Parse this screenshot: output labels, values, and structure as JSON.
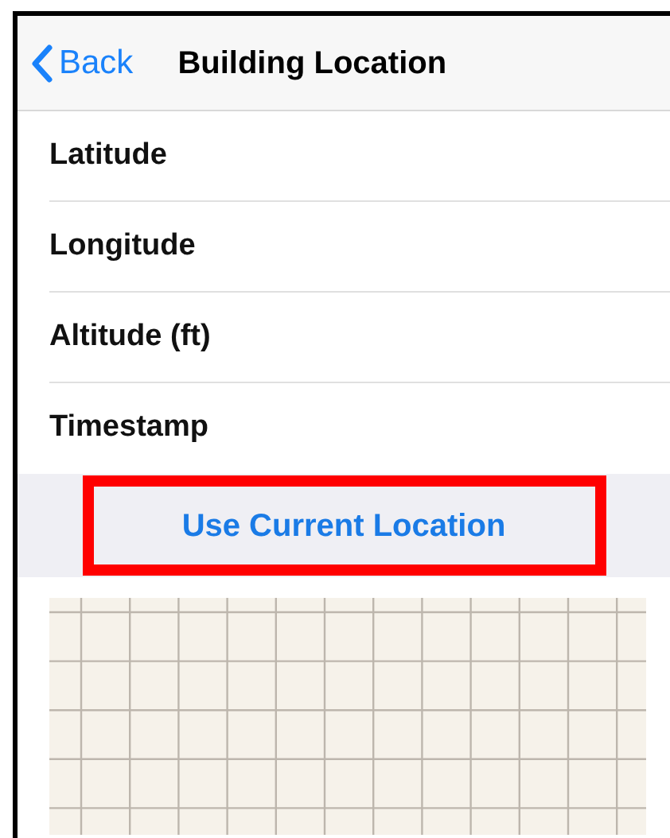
{
  "nav_bar": {
    "back": "Back",
    "title": "Building Location"
  },
  "fields": [
    {
      "label": "Latitude"
    },
    {
      "label": "Longitude"
    },
    {
      "label": "Altitude (ft)"
    },
    {
      "label": "Timestamp"
    }
  ],
  "action": {
    "label": "Use Current Location",
    "highlighted": true
  },
  "map": {
    "kind": "grid"
  }
}
